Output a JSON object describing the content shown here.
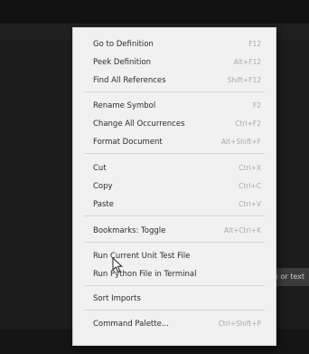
{
  "context_menu": {
    "items": [
      {
        "label": "Go to Definition",
        "shortcut": "F12"
      },
      {
        "label": "Peek Definition",
        "shortcut": "Alt+F12"
      },
      {
        "label": "Find All References",
        "shortcut": "Shift+F12"
      },
      {
        "label": "Rename Symbol",
        "shortcut": "F2"
      },
      {
        "label": "Change All Occurrences",
        "shortcut": "Ctrl+F2"
      },
      {
        "label": "Format Document",
        "shortcut": "Alt+Shift+F"
      },
      {
        "label": "Cut",
        "shortcut": "Ctrl+X"
      },
      {
        "label": "Copy",
        "shortcut": "Ctrl+C"
      },
      {
        "label": "Paste",
        "shortcut": "Ctrl+V"
      },
      {
        "label": "Bookmarks: Toggle",
        "shortcut": "Alt+Ctrl+K"
      },
      {
        "label": "Run Current Unit Test File",
        "shortcut": ""
      },
      {
        "label": "Run Python File in Terminal",
        "shortcut": ""
      },
      {
        "label": "Sort Imports",
        "shortcut": ""
      },
      {
        "label": "Command Palette...",
        "shortcut": "Ctrl+Shift+P"
      }
    ]
  },
  "background": {
    "hint_text": "e or text"
  },
  "colors": {
    "menu_background": "#f1f1f1",
    "menu_text": "#2b2b2b",
    "shortcut_text": "#a9a9a9",
    "editor_background": "#1c1c1c"
  }
}
